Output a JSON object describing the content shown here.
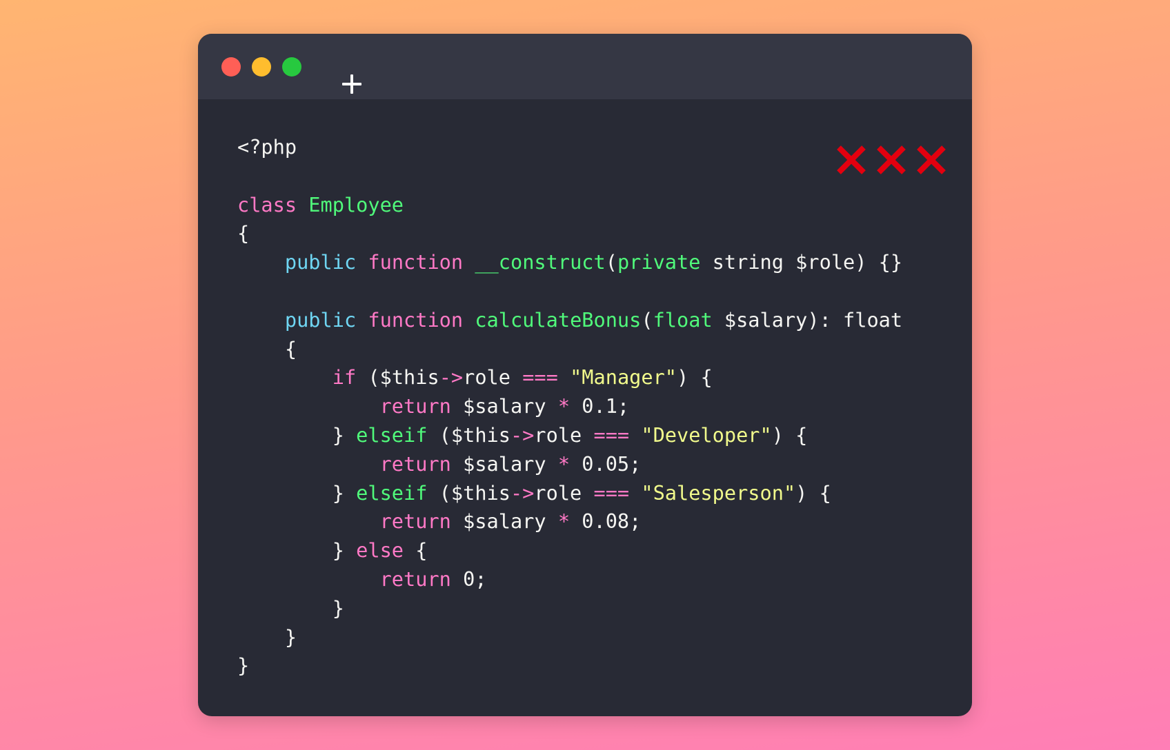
{
  "window": {
    "controls": [
      {
        "name": "close",
        "color": "#ff5f56"
      },
      {
        "name": "minimize",
        "color": "#ffbd2e"
      },
      {
        "name": "zoom",
        "color": "#27c93f"
      }
    ],
    "new_tab_icon": "plus-icon",
    "marks": {
      "count": 3,
      "icon": "x-mark-icon",
      "color": "#e3000f"
    }
  },
  "colors": {
    "plain": "#f5f5f2",
    "keyword": "#ff79c6",
    "class_name": "#50fa7b",
    "modifier": "#6fd6f3",
    "function": "#50fa7b",
    "type": "#50fa7b",
    "operator": "#ff79c6",
    "string": "#f1fa8c",
    "editor_bg": "#282a35",
    "titlebar_bg": "#353744"
  },
  "code": {
    "language": "php",
    "lines": [
      [
        {
          "t": "plain",
          "s": "<?php"
        }
      ],
      [],
      [
        {
          "t": "keyword",
          "s": "class"
        },
        {
          "t": "plain",
          "s": " "
        },
        {
          "t": "classname",
          "s": "Employee"
        }
      ],
      [
        {
          "t": "plain",
          "s": "{"
        }
      ],
      [
        {
          "t": "plain",
          "s": "    "
        },
        {
          "t": "modifier",
          "s": "public"
        },
        {
          "t": "plain",
          "s": " "
        },
        {
          "t": "keyword",
          "s": "function"
        },
        {
          "t": "plain",
          "s": " "
        },
        {
          "t": "func",
          "s": "__construct"
        },
        {
          "t": "plain",
          "s": "("
        },
        {
          "t": "type",
          "s": "private"
        },
        {
          "t": "plain",
          "s": " string $role) {}"
        }
      ],
      [],
      [
        {
          "t": "plain",
          "s": "    "
        },
        {
          "t": "modifier",
          "s": "public"
        },
        {
          "t": "plain",
          "s": " "
        },
        {
          "t": "keyword",
          "s": "function"
        },
        {
          "t": "plain",
          "s": " "
        },
        {
          "t": "func",
          "s": "calculateBonus"
        },
        {
          "t": "plain",
          "s": "("
        },
        {
          "t": "type",
          "s": "float"
        },
        {
          "t": "plain",
          "s": " $salary): float"
        }
      ],
      [
        {
          "t": "plain",
          "s": "    {"
        }
      ],
      [
        {
          "t": "plain",
          "s": "        "
        },
        {
          "t": "keyword",
          "s": "if"
        },
        {
          "t": "plain",
          "s": " ($this"
        },
        {
          "t": "op",
          "s": "->"
        },
        {
          "t": "plain",
          "s": "role "
        },
        {
          "t": "op",
          "s": "==="
        },
        {
          "t": "plain",
          "s": " "
        },
        {
          "t": "string",
          "s": "\"Manager\""
        },
        {
          "t": "plain",
          "s": ") {"
        }
      ],
      [
        {
          "t": "plain",
          "s": "            "
        },
        {
          "t": "keyword",
          "s": "return"
        },
        {
          "t": "plain",
          "s": " $salary "
        },
        {
          "t": "op",
          "s": "*"
        },
        {
          "t": "plain",
          "s": " 0.1;"
        }
      ],
      [
        {
          "t": "plain",
          "s": "        } "
        },
        {
          "t": "func",
          "s": "elseif"
        },
        {
          "t": "plain",
          "s": " ($this"
        },
        {
          "t": "op",
          "s": "->"
        },
        {
          "t": "plain",
          "s": "role "
        },
        {
          "t": "op",
          "s": "==="
        },
        {
          "t": "plain",
          "s": " "
        },
        {
          "t": "string",
          "s": "\"Developer\""
        },
        {
          "t": "plain",
          "s": ") {"
        }
      ],
      [
        {
          "t": "plain",
          "s": "            "
        },
        {
          "t": "keyword",
          "s": "return"
        },
        {
          "t": "plain",
          "s": " $salary "
        },
        {
          "t": "op",
          "s": "*"
        },
        {
          "t": "plain",
          "s": " 0.05;"
        }
      ],
      [
        {
          "t": "plain",
          "s": "        } "
        },
        {
          "t": "func",
          "s": "elseif"
        },
        {
          "t": "plain",
          "s": " ($this"
        },
        {
          "t": "op",
          "s": "->"
        },
        {
          "t": "plain",
          "s": "role "
        },
        {
          "t": "op",
          "s": "==="
        },
        {
          "t": "plain",
          "s": " "
        },
        {
          "t": "string",
          "s": "\"Salesperson\""
        },
        {
          "t": "plain",
          "s": ") {"
        }
      ],
      [
        {
          "t": "plain",
          "s": "            "
        },
        {
          "t": "keyword",
          "s": "return"
        },
        {
          "t": "plain",
          "s": " $salary "
        },
        {
          "t": "op",
          "s": "*"
        },
        {
          "t": "plain",
          "s": " 0.08;"
        }
      ],
      [
        {
          "t": "plain",
          "s": "        } "
        },
        {
          "t": "keyword",
          "s": "else"
        },
        {
          "t": "plain",
          "s": " {"
        }
      ],
      [
        {
          "t": "plain",
          "s": "            "
        },
        {
          "t": "keyword",
          "s": "return"
        },
        {
          "t": "plain",
          "s": " 0;"
        }
      ],
      [
        {
          "t": "plain",
          "s": "        }"
        }
      ],
      [
        {
          "t": "plain",
          "s": "    }"
        }
      ],
      [
        {
          "t": "plain",
          "s": "}"
        }
      ]
    ]
  }
}
